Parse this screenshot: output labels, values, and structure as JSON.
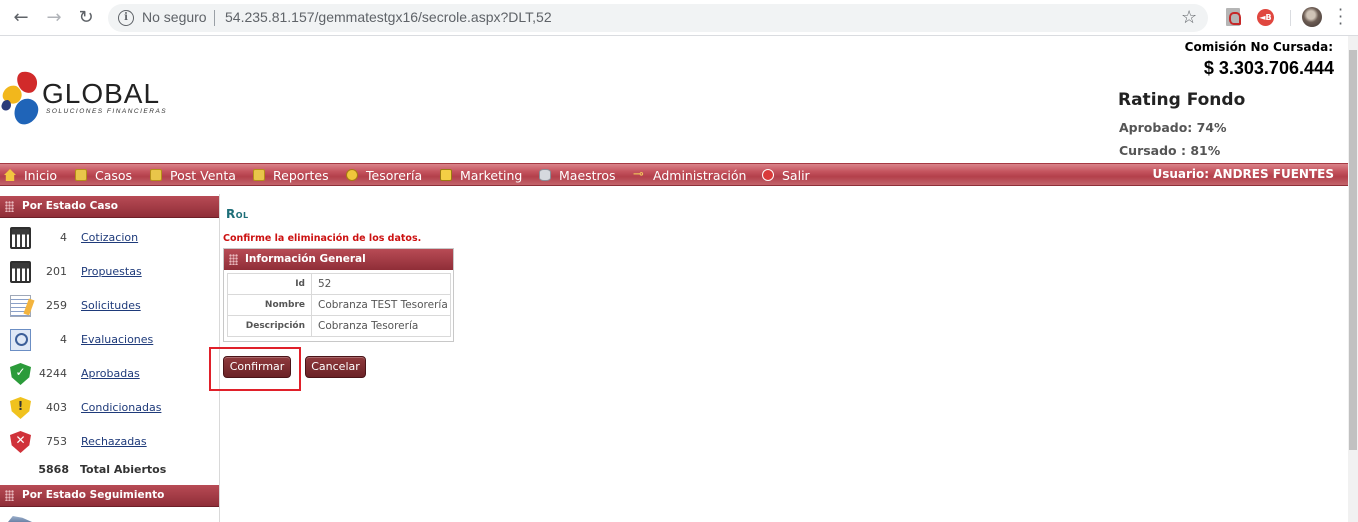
{
  "browser": {
    "security": "No seguro",
    "url": "54.235.81.157/gemmatestgx16/secrole.aspx?DLT,52"
  },
  "brand": {
    "name": "GLOBAL",
    "tagline": "SOLUCIONES FINANCIERAS"
  },
  "header": {
    "commission_label": "Comisión No Cursada:",
    "commission_value": "$ 3.303.706.444",
    "rating_title": "Rating Fondo",
    "approved": "Aprobado: 74%",
    "coursed": "Cursado : 81%"
  },
  "menu": {
    "items": [
      {
        "label": "Inicio",
        "icon": "home-icon"
      },
      {
        "label": "Casos",
        "icon": "folder-icon"
      },
      {
        "label": "Post Venta",
        "icon": "folder-icon"
      },
      {
        "label": "Reportes",
        "icon": "folder-icon"
      },
      {
        "label": "Tesorería",
        "icon": "coin-icon"
      },
      {
        "label": "Marketing",
        "icon": "screen-icon"
      },
      {
        "label": "Maestros",
        "icon": "database-icon"
      },
      {
        "label": "Administración",
        "icon": "key-icon"
      },
      {
        "label": "Salir",
        "icon": "exit-icon"
      }
    ],
    "user": "Usuario:  ANDRES FUENTES"
  },
  "sidebar": {
    "status_title": "Por Estado Caso",
    "cases": [
      {
        "count": "4",
        "label": "Cotizacion",
        "icon": "calculator-icon"
      },
      {
        "count": "201",
        "label": "Propuestas",
        "icon": "calculator-icon"
      },
      {
        "count": "259",
        "label": "Solicitudes",
        "icon": "document-edit-icon"
      },
      {
        "count": "4",
        "label": "Evaluaciones",
        "icon": "magnifier-icon"
      },
      {
        "count": "4244",
        "label": "Aprobadas",
        "icon": "shield-check-icon"
      },
      {
        "count": "403",
        "label": "Condicionadas",
        "icon": "shield-warning-icon"
      },
      {
        "count": "753",
        "label": "Rechazadas",
        "icon": "shield-x-icon"
      }
    ],
    "total_count": "5868",
    "total_label": "Total Abiertos",
    "tracking_title": "Por Estado Seguimiento"
  },
  "main": {
    "title": "Rol",
    "confirm_message": "Confirme la eliminación de los datos.",
    "info_title": "Información General",
    "fields": [
      {
        "key": "Id",
        "value": "52"
      },
      {
        "key": "Nombre",
        "value": "Cobranza TEST Tesorería"
      },
      {
        "key": "Descripción",
        "value": "Cobranza Tesorería"
      }
    ],
    "confirm_button": "Confirmar",
    "cancel_button": "Cancelar"
  },
  "colors": {
    "menu_red": "#b3404b",
    "highlight": "#e0202a",
    "button": "#7a2a2e",
    "title_teal": "#1d6e78",
    "warning_text": "#cc1111"
  }
}
